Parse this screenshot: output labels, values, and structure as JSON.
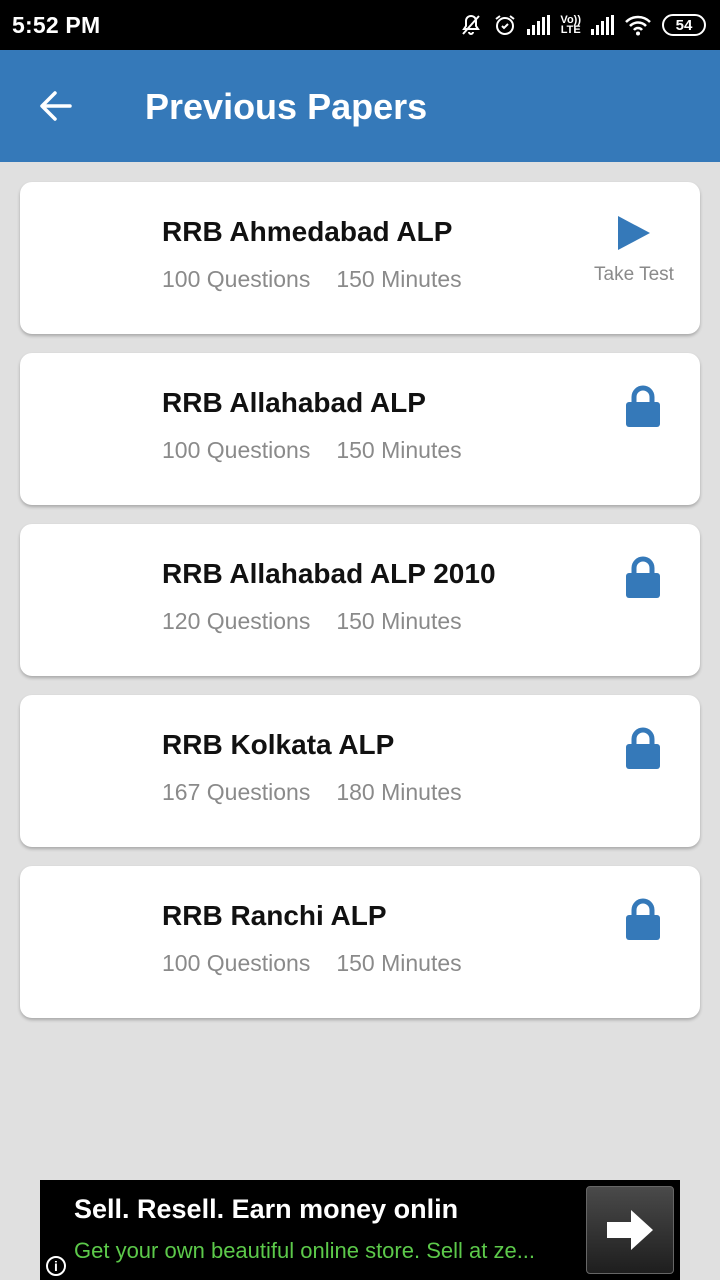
{
  "status_bar": {
    "time": "5:52 PM",
    "icons": [
      "notifications-muted-icon",
      "alarm-icon",
      "signal-icon",
      "volte-icon",
      "signal-icon",
      "wifi-icon",
      "battery-icon"
    ],
    "volte_label_top": "Vo))",
    "volte_label_bottom": "LTE",
    "battery_level": "54"
  },
  "app_bar": {
    "back_icon": "arrow-left-icon",
    "title": "Previous Papers",
    "color": "#3579b9"
  },
  "papers": [
    {
      "title": "RRB Ahmedabad ALP",
      "questions": "100 Questions",
      "minutes": "150 Minutes",
      "status": "unlocked",
      "action_label": "Take Test"
    },
    {
      "title": "RRB Allahabad ALP",
      "questions": "100 Questions",
      "minutes": "150 Minutes",
      "status": "locked"
    },
    {
      "title": "RRB Allahabad ALP 2010",
      "questions": "120 Questions",
      "minutes": "150 Minutes",
      "status": "locked"
    },
    {
      "title": "RRB Kolkata ALP",
      "questions": "167 Questions",
      "minutes": "180 Minutes",
      "status": "locked"
    },
    {
      "title": "RRB Ranchi ALP",
      "questions": "100 Questions",
      "minutes": "150 Minutes",
      "status": "locked"
    }
  ],
  "ad": {
    "title": "Sell. Resell. Earn money onlin",
    "subtitle": "Get your own beautiful online store. Sell at ze...",
    "info_label": "i",
    "subtitle_color": "#5cc94a"
  }
}
